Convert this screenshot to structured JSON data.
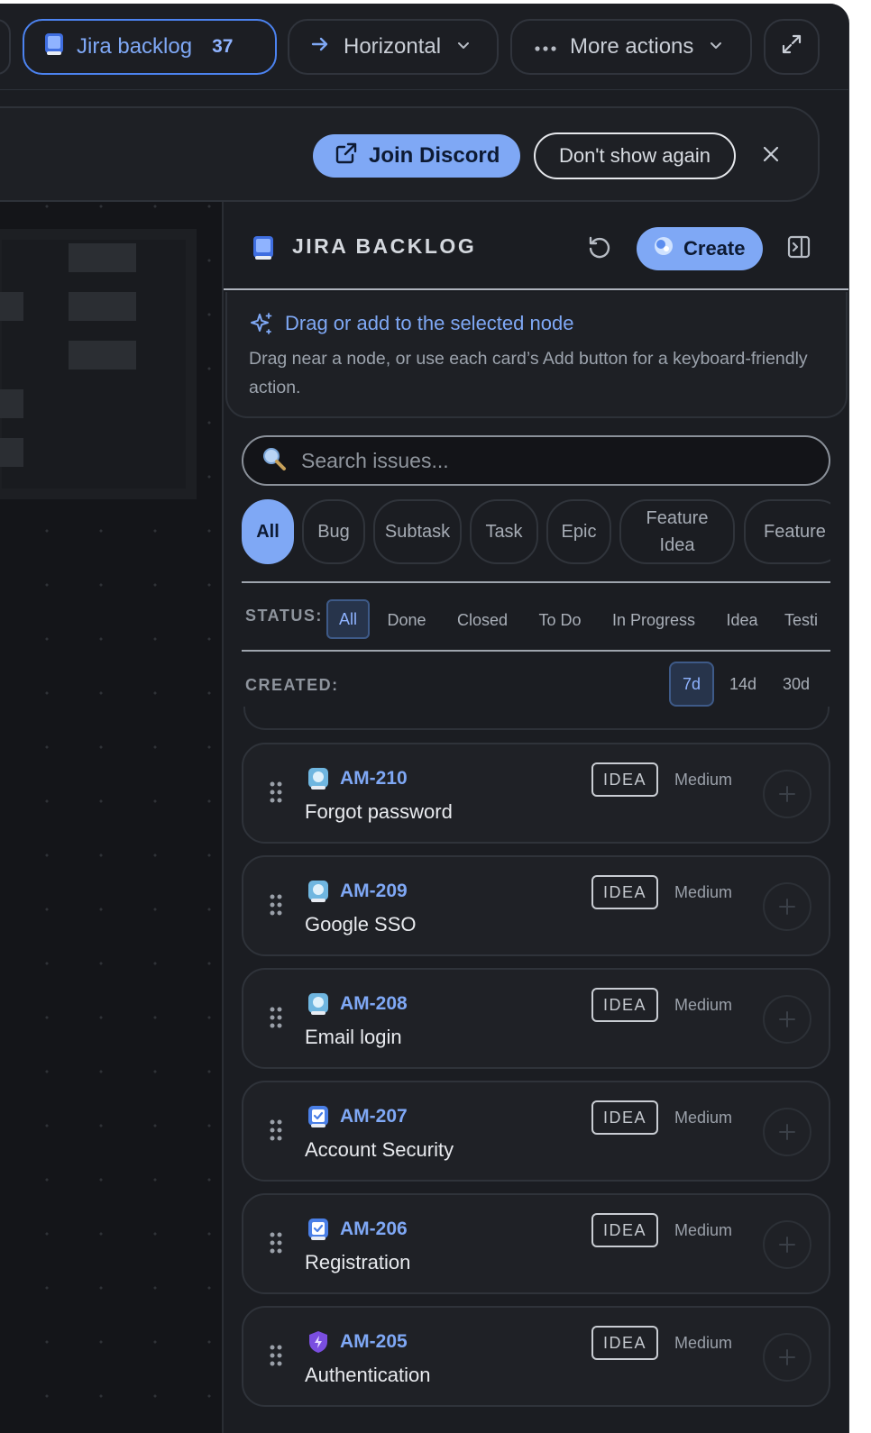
{
  "toolbar": {
    "jira_label": "Jira backlog",
    "jira_count": "37",
    "layout_label": "Horizontal",
    "more_label": "More actions"
  },
  "banner": {
    "discord_label": "Join Discord",
    "dont_show_label": "Don't show again"
  },
  "panel": {
    "title": "JIRA BACKLOG",
    "create_label": "Create",
    "hint_title": "Drag or add to the selected node",
    "hint_body": "Drag near a node, or use each card’s Add button for a keyboard-friendly action.",
    "search_placeholder": "Search issues...",
    "type_filters": [
      "All",
      "Bug",
      "Subtask",
      "Task",
      "Epic",
      "Feature Idea",
      "Feature"
    ],
    "type_active": "All",
    "status_label": "STATUS:",
    "status_filters": [
      "All",
      "Done",
      "Closed",
      "To Do",
      "In Progress",
      "Idea",
      "Testi"
    ],
    "status_active": "All",
    "created_label": "CREATED:",
    "created_filters": [
      "7d",
      "14d",
      "30d"
    ],
    "created_active": "7d"
  },
  "issues": [
    {
      "key": "AM-210",
      "title": "Forgot password",
      "badge": "IDEA",
      "priority": "Medium",
      "icon": "feature-idea-icon"
    },
    {
      "key": "AM-209",
      "title": "Google SSO",
      "badge": "IDEA",
      "priority": "Medium",
      "icon": "feature-idea-icon"
    },
    {
      "key": "AM-208",
      "title": "Email login",
      "badge": "IDEA",
      "priority": "Medium",
      "icon": "feature-idea-icon"
    },
    {
      "key": "AM-207",
      "title": "Account Security",
      "badge": "IDEA",
      "priority": "Medium",
      "icon": "task-icon"
    },
    {
      "key": "AM-206",
      "title": "Registration",
      "badge": "IDEA",
      "priority": "Medium",
      "icon": "task-icon"
    },
    {
      "key": "AM-205",
      "title": "Authentication",
      "badge": "IDEA",
      "priority": "Medium",
      "icon": "epic-icon"
    }
  ],
  "colors": {
    "accent": "#7fa8f5",
    "background": "#1b1d22",
    "canvas": "#141519"
  }
}
